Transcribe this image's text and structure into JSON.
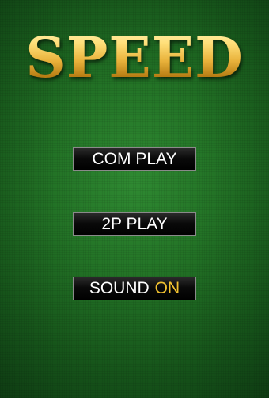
{
  "title": "SPEED",
  "menu": {
    "com_play": "COM PLAY",
    "two_player_play": "2P PLAY",
    "sound_label": "SOUND",
    "sound_state": "ON"
  },
  "colors": {
    "felt_green": "#237326",
    "title_gold": "#f3c84a",
    "button_bg": "#000000",
    "sound_on_accent": "#f2c230"
  }
}
